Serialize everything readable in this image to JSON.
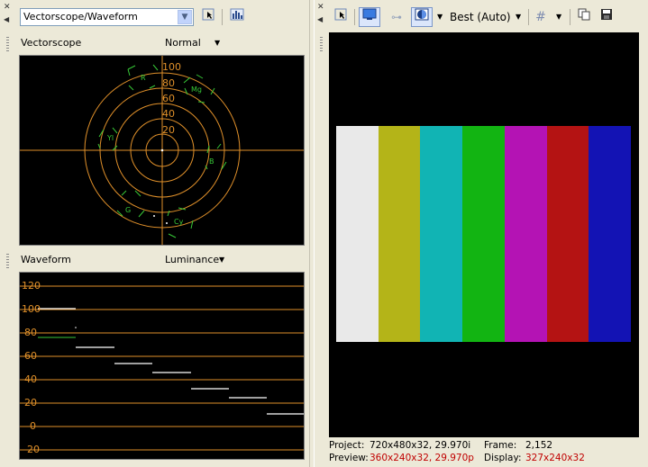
{
  "left_panel": {
    "mode_combo_value": "Vectorscope/Waveform",
    "vectorscope": {
      "title": "Vectorscope",
      "mode": "Normal",
      "ring_labels": [
        "100",
        "80",
        "60",
        "40",
        "20"
      ],
      "targets": [
        "R",
        "Mg",
        "B",
        "Cy",
        "G",
        "Yl"
      ]
    },
    "waveform": {
      "title": "Waveform",
      "mode": "Luminance",
      "ticks": [
        "120",
        "100",
        "80",
        "60",
        "40",
        "20",
        "0",
        "-20"
      ]
    }
  },
  "right_panel": {
    "quality": "Best (Auto)",
    "colorbars": [
      {
        "name": "white",
        "color": "#e9e9e9"
      },
      {
        "name": "yellow",
        "color": "#b4b418"
      },
      {
        "name": "cyan",
        "color": "#11b4b4"
      },
      {
        "name": "green",
        "color": "#12b412"
      },
      {
        "name": "magenta",
        "color": "#b413b4"
      },
      {
        "name": "red",
        "color": "#b41313"
      },
      {
        "name": "blue",
        "color": "#1313b4"
      }
    ],
    "status": {
      "project_key": "Project:",
      "project_val": "720x480x32, 29.970i",
      "frame_key": "Frame:",
      "frame_val": "2,152",
      "preview_key": "Preview:",
      "preview_val": "360x240x32, 29.970p",
      "display_key": "Display:",
      "display_val": "327x240x32"
    }
  },
  "colors": {
    "scope_line": "#e0902a",
    "target_green": "#37c837",
    "status_red": "#c00000"
  }
}
